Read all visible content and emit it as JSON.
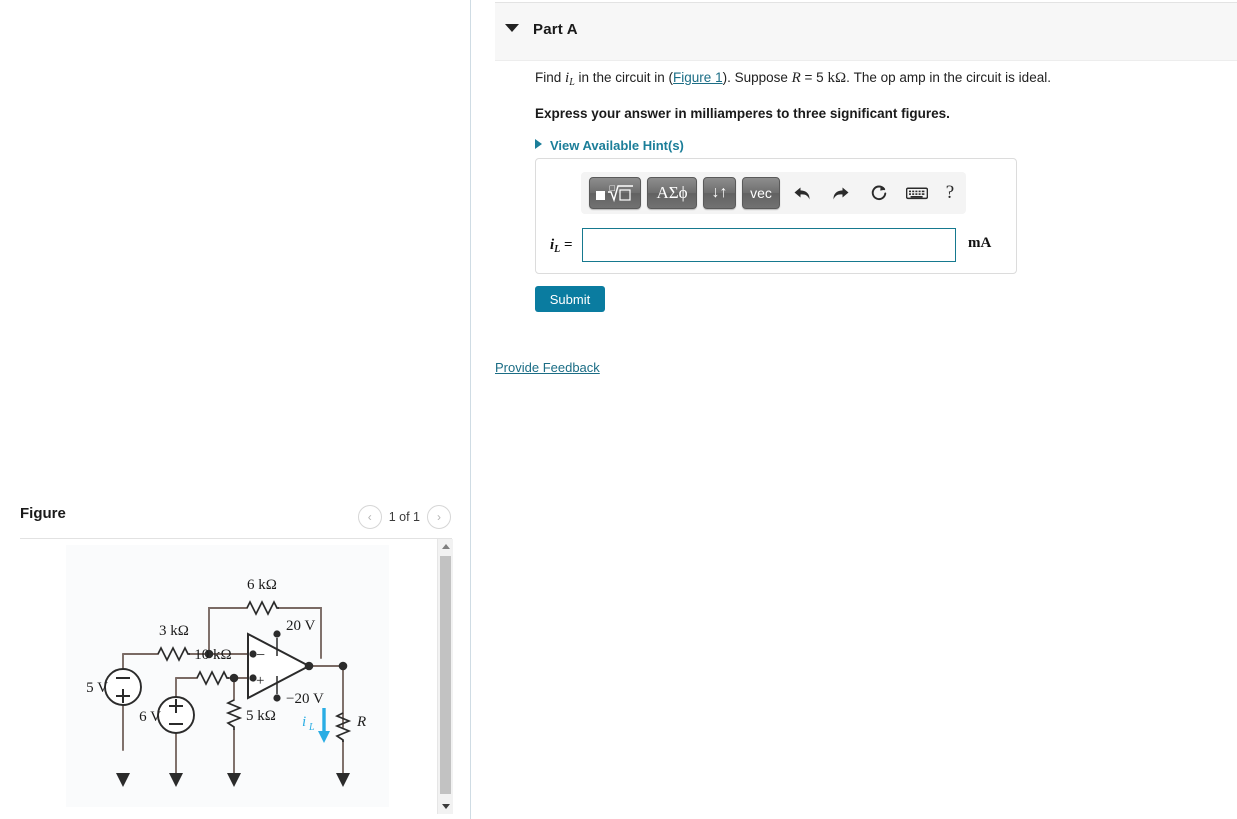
{
  "part": {
    "title": "Part A",
    "caret_icon": "caret-down-icon",
    "prompt_prefix": "Find ",
    "prompt_i": "i",
    "prompt_i_sub": "L",
    "prompt_mid": " in the circuit in (",
    "figure_link": "Figure 1",
    "prompt_after_link": "). Suppose ",
    "prompt_R": "R",
    "prompt_eq": " = 5 ",
    "prompt_kohm": "kΩ",
    "prompt_tail": ". The op amp in the circuit is ideal.",
    "instruction": "Express your answer in milliamperes to three significant figures.",
    "hints_label": "View Available Hint(s)",
    "hints_caret_icon": "caret-right-icon"
  },
  "toolbar": {
    "template_button": "■√□",
    "template_button_name": "math-template-button",
    "greek_button": "ΑΣϕ",
    "arrows_button": "↓↑",
    "vec_button": "vec",
    "undo_icon": "undo-arrow-icon",
    "redo_icon": "redo-arrow-icon",
    "reset_icon": "reset-circular-arrow-icon",
    "keyboard_icon": "keyboard-icon",
    "help_label": "?"
  },
  "answer": {
    "label_i": "i",
    "label_sub": "L",
    "label_eq": " =",
    "value": "",
    "placeholder": "",
    "unit": "mA"
  },
  "actions": {
    "submit_label": "Submit",
    "feedback_label": "Provide Feedback"
  },
  "figure": {
    "title": "Figure",
    "pager_label": "1 of 1",
    "prev_icon": "chevron-left-icon",
    "prev_label": "‹",
    "next_icon": "chevron-right-icon",
    "next_label": "›",
    "scroll_up_icon": "scroll-up-arrow-icon",
    "scroll_down_icon": "scroll-down-arrow-icon"
  },
  "circuit": {
    "alt": "Op-amp circuit schematic",
    "labels": {
      "r6k": "6 kΩ",
      "r3k": "3 kΩ",
      "r10k": "10 kΩ",
      "r5k": "5 kΩ",
      "src5v": "5 V",
      "src6v": "6 V",
      "rail_pos": "20 V",
      "rail_neg": "−20 V",
      "load_r": "R",
      "current_i": "i",
      "current_sub": "L",
      "opamp_minus": "−",
      "opamp_plus": "+",
      "src5_top_sign": "−",
      "src5_bot_sign": "+",
      "src6_top_sign": "+",
      "src6_bot_sign": "−"
    },
    "colors": {
      "wire": "#7a6a64",
      "ink": "#2b2b2b",
      "current_highlight": "#29ade4",
      "bg": "#fafbfc"
    }
  },
  "theme": {
    "accent_teal": "#0a7ca0",
    "link_teal": "#1b6d85",
    "header_bg": "#f7f7f7"
  }
}
